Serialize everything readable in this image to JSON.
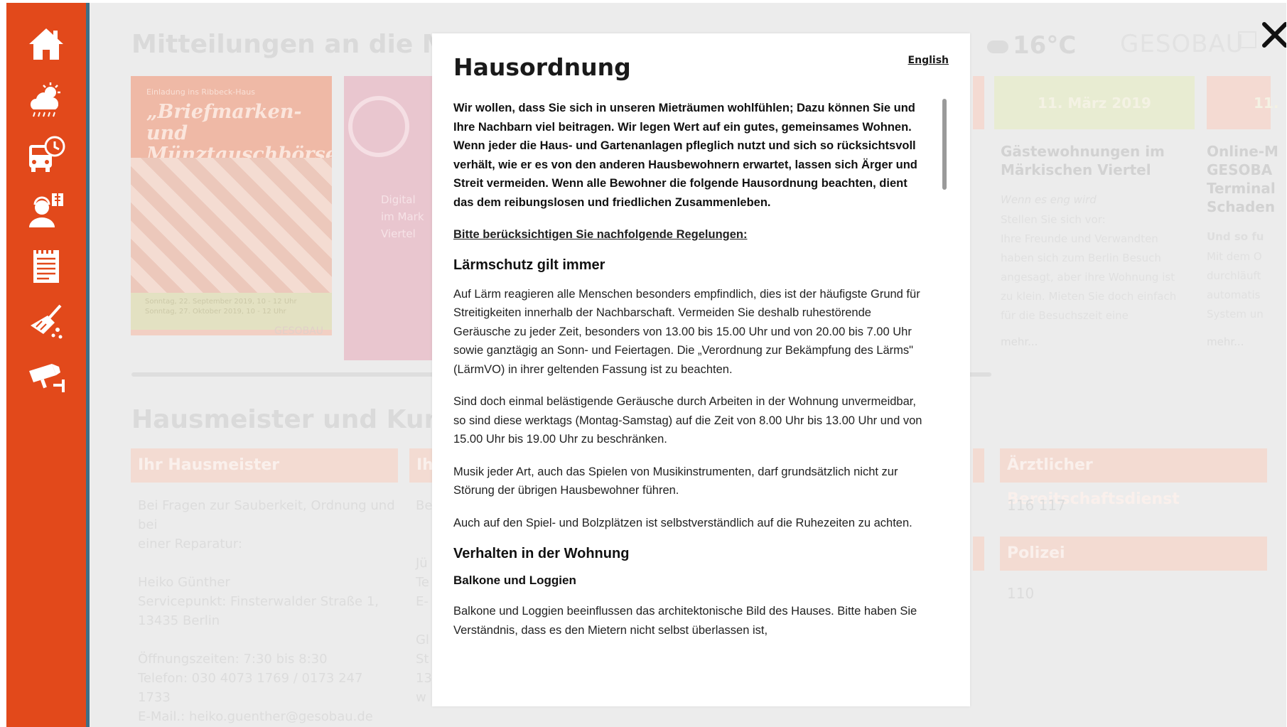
{
  "background": {
    "sections": {
      "notices_title": "Mitteilungen an die Mieter",
      "caretaker_title": "Hausmeister und Kundenbetreuung"
    },
    "weather": {
      "temperature": "16°C",
      "icon": "cloud-icon"
    },
    "brand": "GESOBAU",
    "posters": {
      "first": {
        "kicker": "Einladung ins Ribbeck-Haus",
        "title": "„Briefmarken- und Münztauschbörse“",
        "date_lines": "Sonntag, 22. September 2019, 10 - 12 Uhr\nSonntag, 27. Oktober 2019, 10 - 12 Uhr",
        "brand": "GESOBAU"
      },
      "second": {
        "text": "Digital\nim Mark\nViertel"
      }
    },
    "news": [
      {
        "date": "11. März 2019",
        "title": "Gästewohnungen im\nMärkischen Viertel",
        "subtitle": "Wenn es eng wird",
        "body": "Stellen Sie sich vor:\nIhre Freunde und Verwandten\nhaben sich zum Berlin Besuch\nangesagt, aber ihre Wohnung ist\nzu klein. Mieten Sie doch einfach\nfür die Besuchszeit eine",
        "more": "mehr..."
      },
      {
        "date": "11.",
        "title": "Online-M\nGESOBA\nTerminal\nSchaden",
        "subtitle": "Und so fu",
        "body": "Mit dem O\ndurchläuft\nautomatis\nSystem un",
        "more": "mehr..."
      }
    ],
    "boxes": {
      "caretaker": {
        "header": "Ihr Hausmeister",
        "text": "Bei Fragen zur Sauberkeit, Ordnung und bei\neiner Reparatur:\n\nHeiko Günther\nServicepunkt: Finsterwalder Straße 1,\n13435 Berlin\n\nÖffnungszeiten: 7:30 bis 8:30\nTelefon: 030 4073 1769 / 0173 247 1733\nE-Mail.: heiko.guenther@gesobau.de"
      },
      "second_header": "Ih",
      "second_text": "Be\n\n\nJü\nTe\nE-\n\nGl\nSt\n13\nw",
      "doctor": {
        "header": "Ärztlicher Bereitschaftsdienst",
        "number": "116 117"
      },
      "police": {
        "header": "Polizei",
        "number": "110"
      }
    }
  },
  "sidebar": {
    "items": [
      {
        "icon": "home-icon"
      },
      {
        "icon": "weather-icon"
      },
      {
        "icon": "bus-schedule-icon"
      },
      {
        "icon": "contact-person-icon"
      },
      {
        "icon": "house-rules-document-icon"
      },
      {
        "icon": "cleaning-broom-icon"
      },
      {
        "icon": "security-camera-icon"
      }
    ]
  },
  "modal": {
    "title": "Hausordnung",
    "language_link": "English",
    "intro": "Wir wollen, dass Sie sich in unseren Mieträumen wohlfühlen; Dazu können Sie und Ihre Nachbarn viel beitragen. Wir legen Wert auf ein gutes, gemeinsames Wohnen. Wenn jeder die Haus- und Gartenanlagen pfleglich nutzt und sich so rücksichtsvoll verhält, wie er es von den anderen Hausbewohnern erwartet, lassen sich Ärger und Streit vermeiden. Wenn alle Bewohner die folgende Hausordnung beachten, dient das dem reibungslosen und friedlichen Zusammenleben.",
    "rules_link": "Bitte berücksichtigen Sie nachfolgende Regelungen:",
    "noise": {
      "heading": "Lärmschutz gilt immer",
      "p1": "Auf Lärm reagieren alle Menschen besonders empfindlich, dies ist der häufigste Grund für Streitigkeiten innerhalb der Nachbarschaft. Vermeiden Sie deshalb ruhestörende Geräusche zu jeder Zeit, besonders von 13.00 bis 15.00 Uhr und von 20.00 bis 7.00 Uhr sowie ganztägig an Sonn- und Feiertagen. Die „Verordnung zur Bekämpfung des Lärms\" (LärmVO) in ihrer geltenden Fassung ist zu beachten.",
      "p2": "Sind doch einmal belästigende Geräusche durch Arbeiten in der Wohnung unvermeidbar, so sind diese werktags (Montag-Samstag) auf die Zeit von 8.00 Uhr bis 13.00 Uhr und von 15.00 Uhr bis 19.00 Uhr zu beschränken.",
      "p3": "Musik jeder Art, auch das Spielen von Musikinstrumenten, darf grundsätzlich nicht zur Störung der übrigen Hausbewohner führen.",
      "p4": "Auch auf den Spiel- und Bolzplätzen ist selbstverständlich auf die Ruhezeiten zu achten."
    },
    "apartment": {
      "heading": "Verhalten in der Wohnung",
      "subheading": "Balkone und Loggien",
      "p1": "Balkone und Loggien beeinflussen das architektonische Bild des Hauses. Bitte haben Sie Verständnis, dass es den Mietern nicht selbst überlassen ist,"
    }
  },
  "close_button": {
    "icon": "close-icon"
  },
  "colors": {
    "sidebar": "#e2491b",
    "sidebar_border": "#3f6f86",
    "modal_bg": "#ffffff",
    "text": "#222222"
  }
}
